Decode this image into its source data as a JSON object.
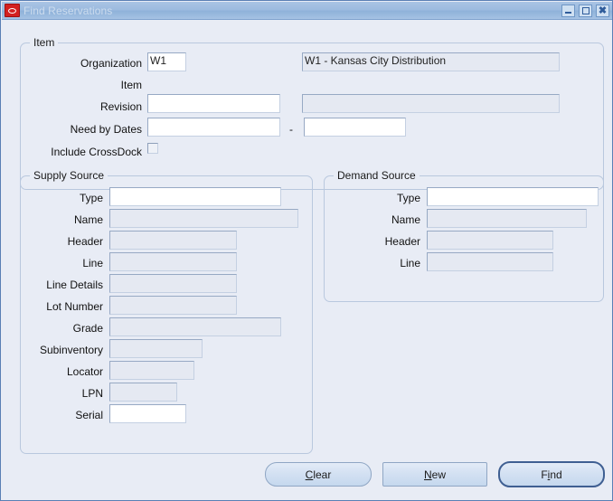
{
  "window": {
    "title": "Find Reservations",
    "app_icon": "oracle-logo-icon",
    "controls": {
      "minimize": "minimize-icon",
      "maximize": "maximize-icon",
      "close": "close-icon"
    }
  },
  "item_section": {
    "legend": "Item",
    "fields": [
      {
        "label": "Organization",
        "value": "W1",
        "state": "enabled"
      },
      {
        "label": "Item",
        "value": "",
        "state": "enabled"
      },
      {
        "label": "Revision",
        "value": "",
        "state": "readonly"
      },
      {
        "label": "Need by Dates",
        "value": "",
        "state": "enabled"
      }
    ],
    "description_fields": [
      {
        "value": "W1 - Kansas City Distribution",
        "state": "readonly"
      },
      {
        "value": "",
        "state": "readonly"
      }
    ],
    "need_by_date_to": {
      "value": "",
      "state": "enabled"
    },
    "date_range_separator": "-",
    "crossdock": {
      "label": "Include CrossDock",
      "checked": false
    }
  },
  "supply_source": {
    "legend": "Supply Source",
    "fields": [
      {
        "label": "Type",
        "value": "",
        "state": "enabled"
      },
      {
        "label": "Name",
        "value": "",
        "state": "readonly"
      },
      {
        "label": "Header",
        "value": "",
        "state": "readonly"
      },
      {
        "label": "Line",
        "value": "",
        "state": "readonly"
      },
      {
        "label": "Line Details",
        "value": "",
        "state": "readonly"
      },
      {
        "label": "Lot Number",
        "value": "",
        "state": "readonly"
      },
      {
        "label": "Grade",
        "value": "",
        "state": "readonly"
      },
      {
        "label": "Subinventory",
        "value": "",
        "state": "readonly"
      },
      {
        "label": "Locator",
        "value": "",
        "state": "readonly"
      },
      {
        "label": "LPN",
        "value": "",
        "state": "readonly"
      },
      {
        "label": "Serial",
        "value": "",
        "state": "enabled"
      }
    ]
  },
  "demand_source": {
    "legend": "Demand Source",
    "fields": [
      {
        "label": "Type",
        "value": "",
        "state": "enabled"
      },
      {
        "label": "Name",
        "value": "",
        "state": "readonly"
      },
      {
        "label": "Header",
        "value": "",
        "state": "readonly"
      },
      {
        "label": "Line",
        "value": "",
        "state": "readonly"
      }
    ]
  },
  "buttons": {
    "clear": {
      "label": "Clear",
      "mnemonic": "C"
    },
    "new": {
      "label": "New",
      "mnemonic": "N"
    },
    "find": {
      "label": "Find",
      "mnemonic": "i",
      "is_default": true
    }
  }
}
